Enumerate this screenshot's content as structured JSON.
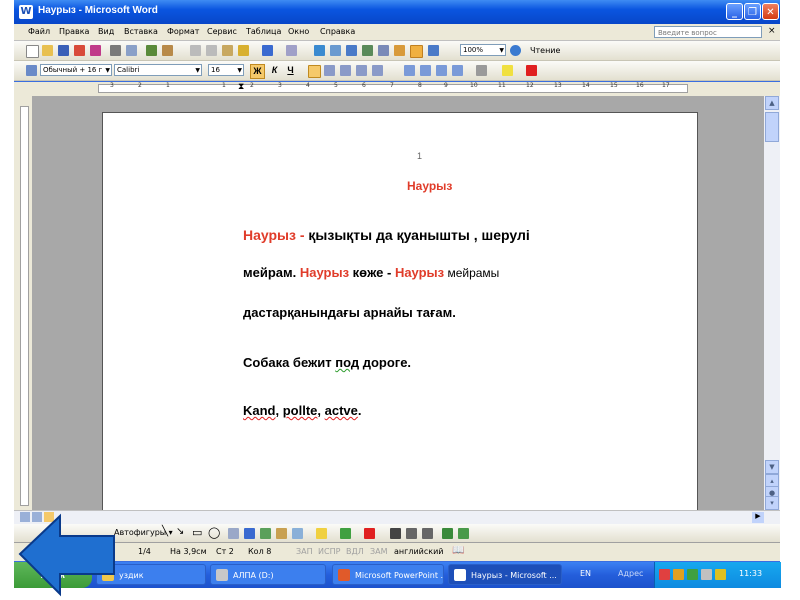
{
  "window": {
    "title": "Наурыз - Microsoft Word",
    "title_icon": "W"
  },
  "menu": {
    "items": [
      "Файл",
      "Правка",
      "Вид",
      "Вставка",
      "Формат",
      "Сервис",
      "Таблица",
      "Окно",
      "Справка"
    ],
    "ask_placeholder": "Введите вопрос",
    "close": "×"
  },
  "standard_toolbar": {
    "zoom": "100%",
    "reading_label": "Чтение"
  },
  "formatting_toolbar": {
    "style": "Обычный + 16 г",
    "font": "Calibri",
    "size": "16",
    "bold": "Ж",
    "italic": "К",
    "underline": "Ч"
  },
  "ruler": {
    "numbers": [
      "3",
      "2",
      "1",
      "1",
      "2",
      "3",
      "4",
      "5",
      "6",
      "7",
      "8",
      "9",
      "10",
      "11",
      "12",
      "13",
      "14",
      "15",
      "16",
      "17"
    ]
  },
  "document": {
    "page_number": "1",
    "heading": "Наурыз",
    "line1_red": "Наурыз -",
    "line1_rest": " қызықты да қуанышты , шерулі",
    "line2_a": "мейрам.",
    "line2_red1": " Наурыз",
    "line2_b": " көже -",
    "line2_red2": " Наурыз",
    "line2_c": " мейрамы",
    "line3": "дастарқанындағы арнайы тағам.",
    "line4_a": "Собака бежит ",
    "line4_b": "под",
    "line4_c": "  дороге.",
    "line5_a": "Kand",
    "line5_b": ", ",
    "line5_c": "pollte",
    "line5_d": ", ",
    "line5_e": "actve",
    "line5_f": "."
  },
  "drawing_toolbar": {
    "autoshapes": "Автофигуры ▾"
  },
  "status": {
    "page": "1/4",
    "at": "На 3,9см",
    "line": "Ст 2",
    "col": "Кол 8",
    "rec": "ЗАП",
    "trk": "ИСПР",
    "ext": "ВДЛ",
    "ovr": "ЗАМ",
    "lang": "английский"
  },
  "taskbar": {
    "start": "пуск",
    "items": [
      {
        "label": "уздик",
        "color": "#f0c84a"
      },
      {
        "label": "АЛПА (D:)",
        "color": "#c8c8c8"
      },
      {
        "label": "Microsoft PowerPoint ...",
        "color": "#e05a2a"
      },
      {
        "label": "Наурыз - Microsoft ...",
        "color": "#2a5fd0"
      }
    ],
    "lang": "EN",
    "address": "Адрес",
    "clock": "11:33"
  },
  "colors": {
    "accent_red": "#e03c2a",
    "title_blue": "#0a55e0",
    "arrow_blue": "#1f6fd0"
  }
}
